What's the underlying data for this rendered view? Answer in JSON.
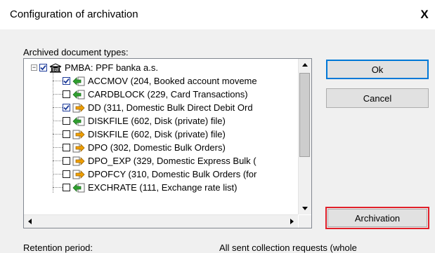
{
  "window": {
    "title": "Configuration of archivation",
    "close_glyph": "X"
  },
  "archived_types": {
    "label": "Archived document types:",
    "root": {
      "label": "PMBA: PPF banka a.s.",
      "checked": true,
      "expanded": true,
      "icon": "bank-icon"
    },
    "items": [
      {
        "label": "ACCMOV (204, Booked account moveme",
        "checked": true,
        "icon": "arrow-left-green-icon"
      },
      {
        "label": "CARDBLOCK (229, Card Transactions)",
        "checked": false,
        "icon": "arrow-left-green-icon"
      },
      {
        "label": "DD (311, Domestic Bulk Direct Debit Ord",
        "checked": true,
        "icon": "arrow-right-orange-icon"
      },
      {
        "label": "DISKFILE (602, Disk (private) file)",
        "checked": false,
        "icon": "arrow-left-green-icon"
      },
      {
        "label": "DISKFILE (602, Disk (private) file)",
        "checked": false,
        "icon": "arrow-right-orange-icon"
      },
      {
        "label": "DPO (302, Domestic Bulk Orders)",
        "checked": false,
        "icon": "arrow-right-orange-icon"
      },
      {
        "label": "DPO_EXP (329, Domestic Express Bulk (",
        "checked": false,
        "icon": "arrow-right-orange-icon"
      },
      {
        "label": "DPOFCY (310, Domestic Bulk Orders (for",
        "checked": false,
        "icon": "arrow-right-orange-icon"
      },
      {
        "label": "EXCHRATE (111, Exchange rate list)",
        "checked": false,
        "icon": "arrow-left-green-icon"
      }
    ]
  },
  "buttons": {
    "ok": "Ok",
    "cancel": "Cancel",
    "archivation": "Archivation"
  },
  "bottom": {
    "retention_label": "Retention period:",
    "collection_text": "All sent collection requests (whole"
  },
  "colors": {
    "highlight": "#e0202a",
    "check": "#1e3c9a",
    "green_arrow": "#2fa12f",
    "orange_arrow": "#f0a000"
  }
}
